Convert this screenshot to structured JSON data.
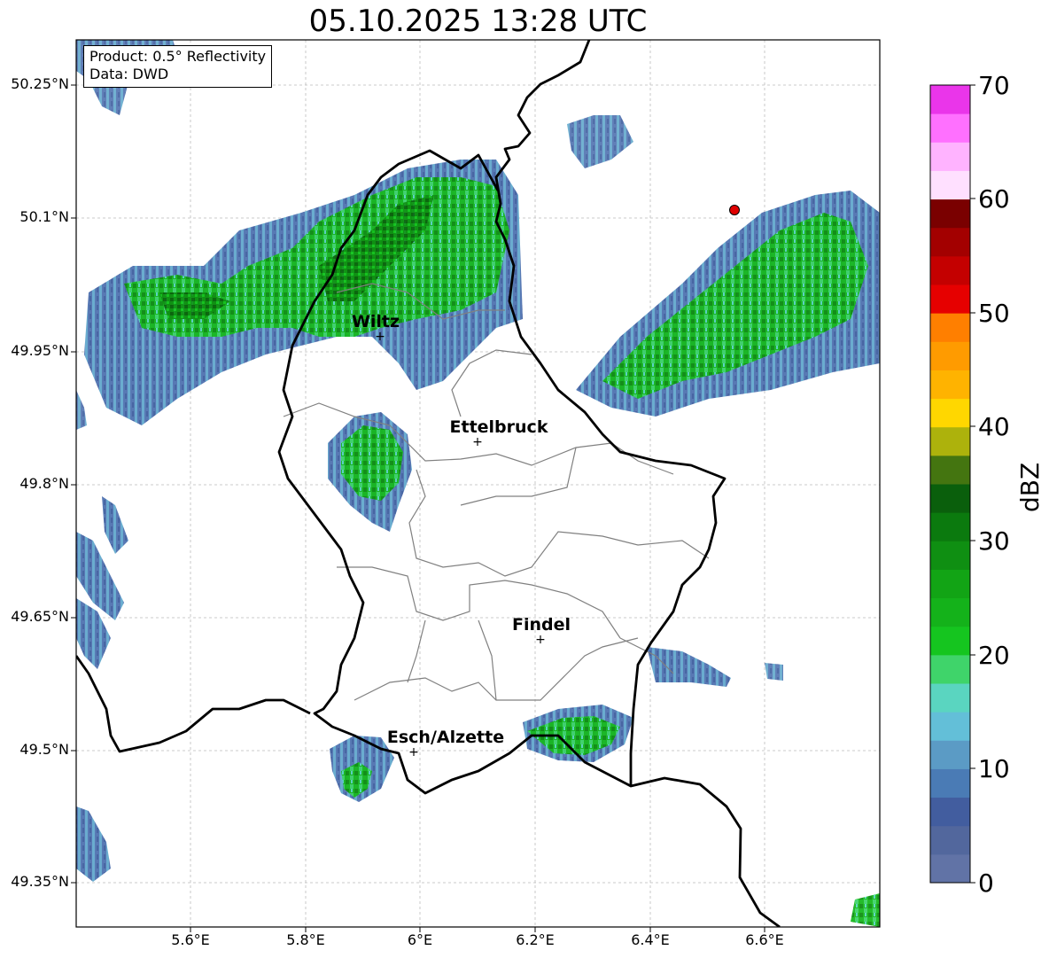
{
  "title": "05.10.2025 13:28 UTC",
  "info_box": {
    "product": "Product: 0.5° Reflectivity",
    "data": "Data: DWD"
  },
  "lat_ticks": [
    "50.25°N",
    "50.1°N",
    "49.95°N",
    "49.8°N",
    "49.65°N",
    "49.5°N",
    "49.35°N"
  ],
  "lon_ticks": [
    "5.6°E",
    "5.8°E",
    "6°E",
    "6.2°E",
    "6.4°E",
    "6.6°E"
  ],
  "cities": [
    {
      "name": "Wiltz",
      "lon": 5.93,
      "lat": 49.97
    },
    {
      "name": "Ettelbruck",
      "lon": 6.1,
      "lat": 49.85
    },
    {
      "name": "Findel",
      "lon": 6.21,
      "lat": 49.63
    },
    {
      "name": "Esch/Alzette",
      "lon": 5.99,
      "lat": 49.5
    }
  ],
  "radar_site": {
    "lon": 6.55,
    "lat": 50.11
  },
  "colorbar": {
    "label": "dBZ",
    "ticks": [
      "0",
      "10",
      "20",
      "30",
      "40",
      "50",
      "60",
      "70"
    ],
    "colors": [
      "#6173a6",
      "#52679d",
      "#425d9f",
      "#4a7bb5",
      "#5b9bc5",
      "#63bfd8",
      "#5ad5c0",
      "#3fd46a",
      "#15c51f",
      "#14b21a",
      "#12a415",
      "#0f8f12",
      "#0b7a0e",
      "#0a5f0c",
      "#447510",
      "#adb20c",
      "#ffd700",
      "#ffb300",
      "#ff9b00",
      "#ff7f00",
      "#e60000",
      "#c40000",
      "#a30000",
      "#7a0000",
      "#ffe0ff",
      "#ffb3ff",
      "#ff70ff",
      "#ea35ea"
    ]
  },
  "colors": {
    "border": "#000000",
    "cantons": "#808080",
    "grid": "#bbbbbb"
  }
}
